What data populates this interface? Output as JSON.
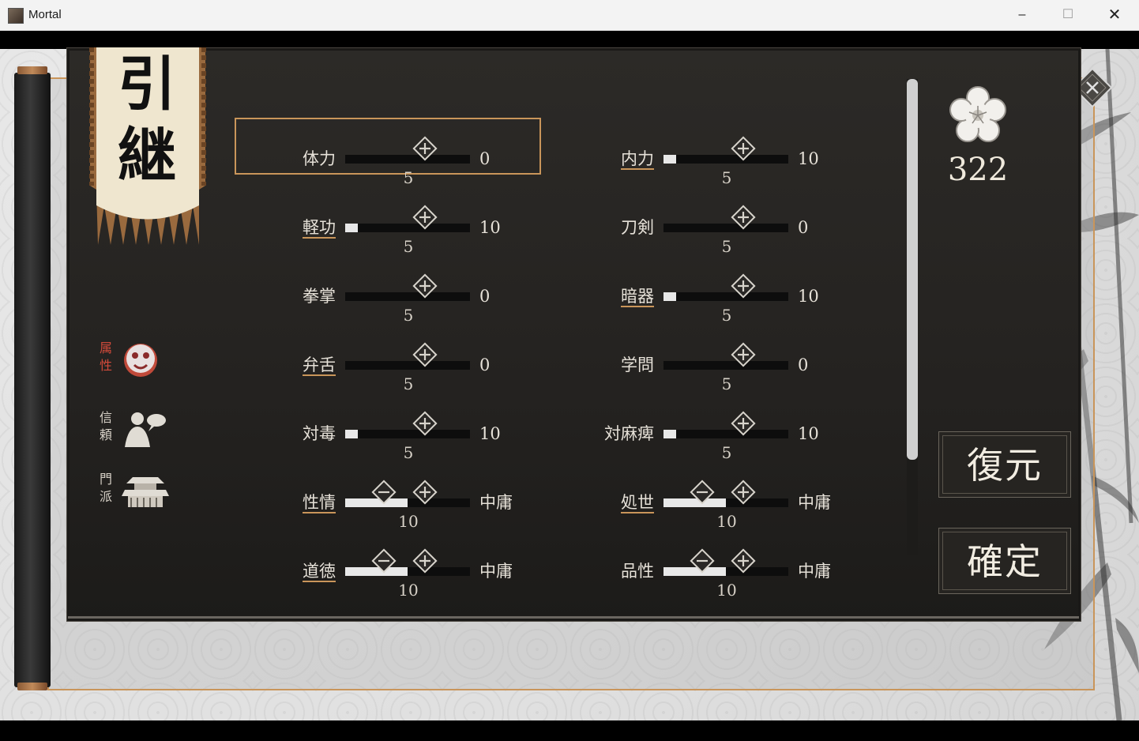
{
  "window": {
    "title": "Mortal",
    "min": "–",
    "max": "☐",
    "close": "✕"
  },
  "banner": {
    "line1": "引",
    "line2": "継"
  },
  "side_nav": [
    {
      "label_a": "属",
      "label_b": "性",
      "icon": "mask-icon",
      "active": true
    },
    {
      "label_a": "信",
      "label_b": "頼",
      "icon": "person-speech-icon",
      "active": false
    },
    {
      "label_a": "門",
      "label_b": "派",
      "icon": "temple-icon",
      "active": false
    }
  ],
  "stats_left": [
    {
      "label": "体力",
      "value": "0",
      "sub": "5",
      "fill": 0,
      "link": false,
      "minus": false,
      "selected": true
    },
    {
      "label": "軽功",
      "value": "10",
      "sub": "5",
      "fill": 0.1,
      "link": true,
      "minus": false
    },
    {
      "label": "拳掌",
      "value": "0",
      "sub": "5",
      "fill": 0,
      "link": false,
      "minus": false
    },
    {
      "label": "弁舌",
      "value": "0",
      "sub": "5",
      "fill": 0,
      "link": true,
      "minus": false
    },
    {
      "label": "対毒",
      "value": "10",
      "sub": "5",
      "fill": 0.1,
      "link": false,
      "minus": false
    },
    {
      "label": "性情",
      "value": "中庸",
      "sub": "10",
      "fill": 0.5,
      "link": true,
      "minus": true
    },
    {
      "label": "道徳",
      "value": "中庸",
      "sub": "10",
      "fill": 0.5,
      "link": true,
      "minus": true
    }
  ],
  "stats_right": [
    {
      "label": "内力",
      "value": "10",
      "sub": "5",
      "fill": 0.1,
      "link": true,
      "minus": false
    },
    {
      "label": "刀剣",
      "value": "0",
      "sub": "5",
      "fill": 0,
      "link": false,
      "minus": false
    },
    {
      "label": "暗器",
      "value": "10",
      "sub": "5",
      "fill": 0.1,
      "link": true,
      "minus": false
    },
    {
      "label": "学問",
      "value": "0",
      "sub": "5",
      "fill": 0,
      "link": false,
      "minus": false
    },
    {
      "label": "対麻痺",
      "value": "10",
      "sub": "5",
      "fill": 0.1,
      "link": false,
      "minus": false
    },
    {
      "label": "処世",
      "value": "中庸",
      "sub": "10",
      "fill": 0.5,
      "link": true,
      "minus": true
    },
    {
      "label": "品性",
      "value": "中庸",
      "sub": "10",
      "fill": 0.5,
      "link": false,
      "minus": true
    }
  ],
  "points": "322",
  "buttons": {
    "reset": "復元",
    "confirm": "確定"
  },
  "colors": {
    "accent": "#c9955a",
    "panel": "#262421",
    "active_nav": "#d24a3a"
  }
}
